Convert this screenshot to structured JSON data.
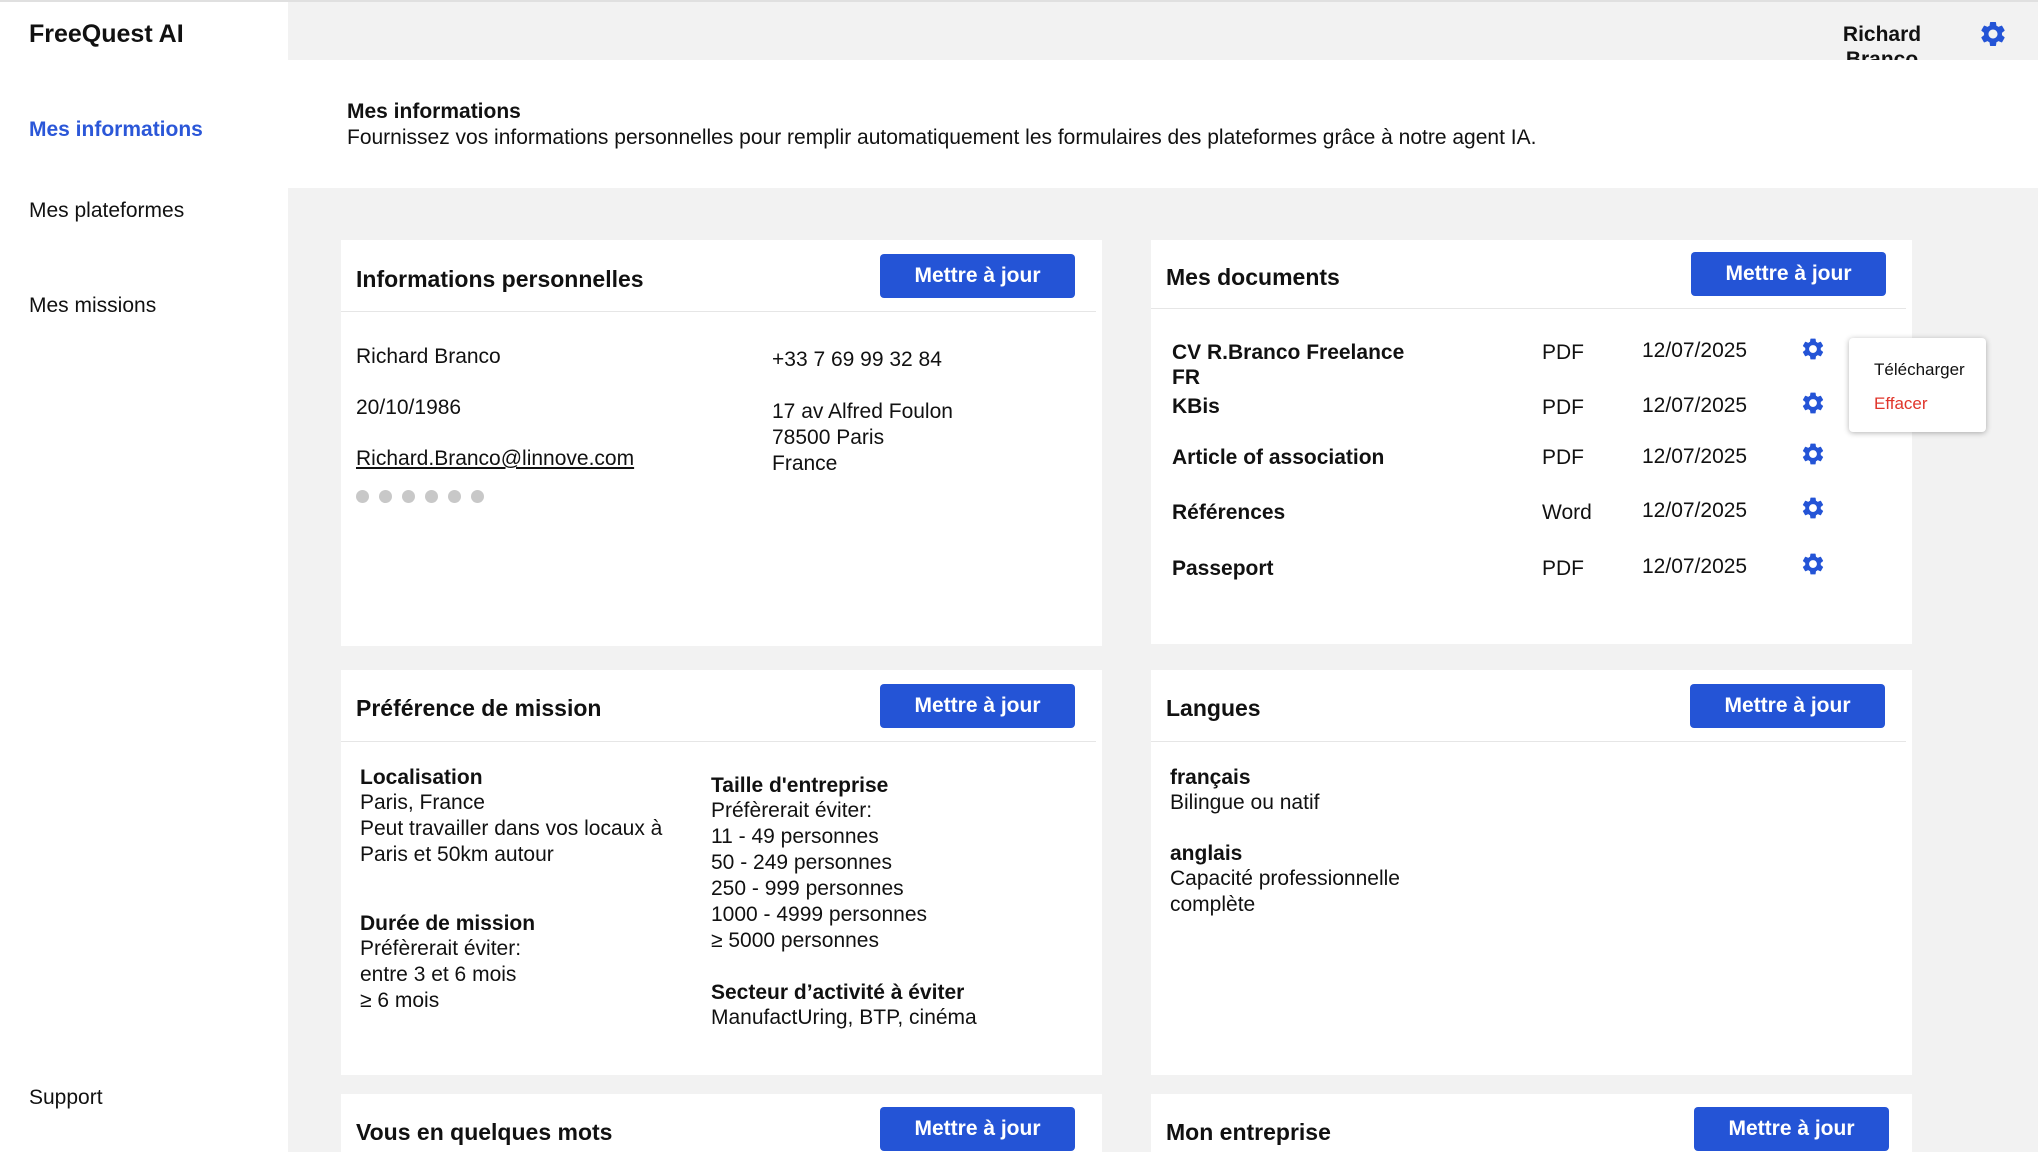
{
  "app": {
    "name": "FreeQuest AI"
  },
  "sidebar": {
    "items": [
      {
        "label": "Mes informations"
      },
      {
        "label": "Mes plateformes"
      },
      {
        "label": "Mes missions"
      }
    ],
    "support": "Support"
  },
  "user": {
    "first_name": "Richard",
    "last_name": "Branco"
  },
  "accent_color": "#2454d6",
  "page": {
    "title": "Mes informations",
    "description": "Fournissez vos informations personnelles pour remplir automatiquement les formulaires des plateformes grâce à notre agent IA."
  },
  "update_label": "Mettre à jour",
  "personal": {
    "title": "Informations personnelles",
    "name": "Richard Branco",
    "birthdate": "20/10/1986",
    "email": "Richard.Branco@linnove.com",
    "password_dots": 6,
    "phone": "+33 7 69 99 32 84",
    "address_line1": "17 av Alfred Foulon",
    "address_line2": "78500 Paris",
    "address_line3": "France"
  },
  "documents": {
    "title": "Mes documents",
    "items": [
      {
        "name": "CV R.Branco Freelance FR",
        "type": "PDF",
        "date": "12/07/2025"
      },
      {
        "name": "KBis",
        "type": "PDF",
        "date": "12/07/2025"
      },
      {
        "name": "Article of association",
        "type": "PDF",
        "date": "12/07/2025"
      },
      {
        "name": "Références",
        "type": "Word",
        "date": "12/07/2025"
      },
      {
        "name": "Passeport",
        "type": "PDF",
        "date": "12/07/2025"
      }
    ],
    "menu": {
      "download": "Télécharger",
      "delete": "Effacer"
    }
  },
  "preferences": {
    "title": "Préférence de mission",
    "location_label": "Localisation",
    "location_value": "Paris, France",
    "location_detail": "Peut travailler dans vos locaux à Paris et 50km autour",
    "duration_label": "Durée de mission",
    "duration_intro": "Préfèrerait éviter:",
    "duration_items": [
      "entre 3 et 6 mois",
      "≥ 6 mois"
    ],
    "size_label": "Taille d'entreprise",
    "size_intro": "Préfèrerait éviter:",
    "size_items": [
      "11 - 49 personnes",
      "50 - 249 personnes",
      "250 - 999 personnes",
      "1000 - 4999 personnes",
      "≥ 5000 personnes"
    ],
    "sector_label": "Secteur d’activité à éviter",
    "sector_value": "ManufactUring, BTP, cinéma"
  },
  "languages": {
    "title": "Langues",
    "items": [
      {
        "name": "français",
        "level": "Bilingue ou natif"
      },
      {
        "name": "anglais",
        "level": "Capacité professionnelle complète"
      }
    ]
  },
  "about": {
    "title": "Vous en quelques mots"
  },
  "company": {
    "title": "Mon entreprise"
  }
}
